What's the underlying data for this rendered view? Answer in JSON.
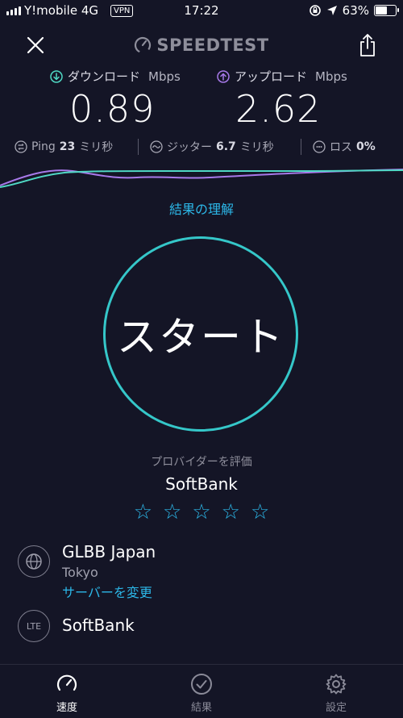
{
  "status_bar": {
    "carrier": "Y!mobile",
    "network": "4G",
    "vpn": "VPN",
    "time": "17:22",
    "battery_percent_text": "63%",
    "battery_level": 0.63
  },
  "header": {
    "brand": "SPEEDTEST"
  },
  "results": {
    "download": {
      "label": "ダウンロード",
      "unit": "Mbps",
      "value": "0.89"
    },
    "upload": {
      "label": "アップロード",
      "unit": "Mbps",
      "value": "2.62"
    },
    "ping": {
      "label": "Ping",
      "value": "23",
      "unit": "ミリ秒"
    },
    "jitter": {
      "label": "ジッター",
      "value": "6.7",
      "unit": "ミリ秒"
    },
    "loss": {
      "label": "ロス",
      "value": "0%"
    }
  },
  "learn_link": "結果の理解",
  "start_button": "スタート",
  "provider": {
    "rate_label": "プロバイダーを評価",
    "name": "SoftBank",
    "stars": [
      "☆",
      "☆",
      "☆",
      "☆",
      "☆"
    ]
  },
  "server": {
    "name": "GLBB Japan",
    "city": "Tokyo",
    "change_label": "サーバーを変更"
  },
  "connection": {
    "type_badge": "LTE",
    "carrier": "SoftBank"
  },
  "tabs": [
    {
      "label": "速度",
      "icon": "speedometer-icon",
      "active": true
    },
    {
      "label": "結果",
      "icon": "check-circle-icon",
      "active": false
    },
    {
      "label": "設定",
      "icon": "gear-icon",
      "active": false
    }
  ],
  "colors": {
    "background": "#141526",
    "accent_blue": "#2cb7e8",
    "start_ring": "#35c7c9",
    "download_accent": "#4fd8c4",
    "upload_accent": "#a779e9"
  }
}
